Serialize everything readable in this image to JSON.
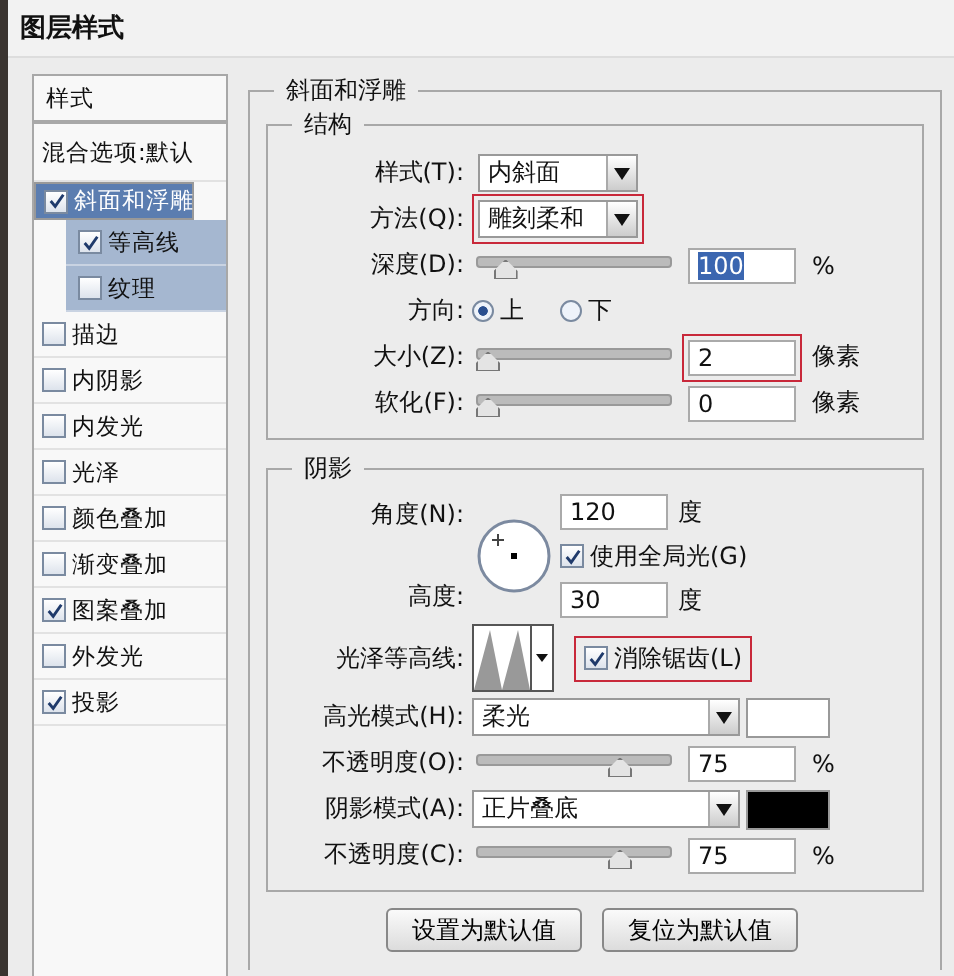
{
  "window": {
    "title": "图层样式"
  },
  "sidebar": {
    "header": "样式",
    "items": [
      {
        "label": "混合选项:默认",
        "kind": "plain",
        "selected": false
      },
      {
        "label": "斜面和浮雕",
        "kind": "check",
        "checked": true,
        "selected": true
      },
      {
        "label": "等高线",
        "kind": "sub",
        "checked": true,
        "selected": false
      },
      {
        "label": "纹理",
        "kind": "sub",
        "checked": false,
        "selected": false
      },
      {
        "label": "描边",
        "kind": "check",
        "checked": false,
        "selected": false
      },
      {
        "label": "内阴影",
        "kind": "check",
        "checked": false,
        "selected": false
      },
      {
        "label": "内发光",
        "kind": "check",
        "checked": false,
        "selected": false
      },
      {
        "label": "光泽",
        "kind": "check",
        "checked": false,
        "selected": false
      },
      {
        "label": "颜色叠加",
        "kind": "check",
        "checked": false,
        "selected": false
      },
      {
        "label": "渐变叠加",
        "kind": "check",
        "checked": false,
        "selected": false
      },
      {
        "label": "图案叠加",
        "kind": "check",
        "checked": true,
        "selected": false
      },
      {
        "label": "外发光",
        "kind": "check",
        "checked": false,
        "selected": false
      },
      {
        "label": "投影",
        "kind": "check",
        "checked": true,
        "selected": false
      }
    ]
  },
  "panel": {
    "title": "斜面和浮雕",
    "structure": {
      "title": "结构",
      "rows": [
        {
          "kind": "select",
          "label": "样式(T):",
          "value": "内斜面"
        },
        {
          "kind": "select",
          "label": "方法(Q):",
          "value": "雕刻柔和",
          "highlighted": true
        },
        {
          "kind": "slider",
          "label": "深度(D):",
          "level": 0.1,
          "value": "100",
          "unit": "%",
          "text_selected": true
        },
        {
          "kind": "radio",
          "label": "方向:",
          "options": [
            {
              "label": "上",
              "selected": true
            },
            {
              "label": "下",
              "selected": false
            }
          ]
        },
        {
          "kind": "slider",
          "label": "大小(Z):",
          "level": 0,
          "value": "2",
          "unit": "像素",
          "highlighted": true
        },
        {
          "kind": "slider",
          "label": "软化(F):",
          "level": 0,
          "value": "0",
          "unit": "像素"
        }
      ]
    },
    "shading": {
      "title": "阴影",
      "angle": {
        "label": "角度(N):",
        "value": "120",
        "unit": "度"
      },
      "global_light": {
        "label": "使用全局光(G)",
        "checked": true
      },
      "altitude": {
        "label": "高度:",
        "value": "30",
        "unit": "度"
      },
      "gloss_contour": {
        "label": "光泽等高线:"
      },
      "anti_alias": {
        "label": "消除锯齿(L)",
        "checked": true,
        "highlighted": true
      },
      "rows": [
        {
          "kind": "mode",
          "label": "高光模式(H):",
          "value": "柔光",
          "color": "#ffffff"
        },
        {
          "kind": "slider",
          "label": "不透明度(O):",
          "level": 0.75,
          "value": "75",
          "unit": "%"
        },
        {
          "kind": "mode",
          "label": "阴影模式(A):",
          "value": "正片叠底",
          "color": "#000000"
        },
        {
          "kind": "slider",
          "label": "不透明度(C):",
          "level": 0.75,
          "value": "75",
          "unit": "%"
        }
      ]
    }
  },
  "buttons": [
    "设置为默认值",
    "复位为默认值"
  ]
}
